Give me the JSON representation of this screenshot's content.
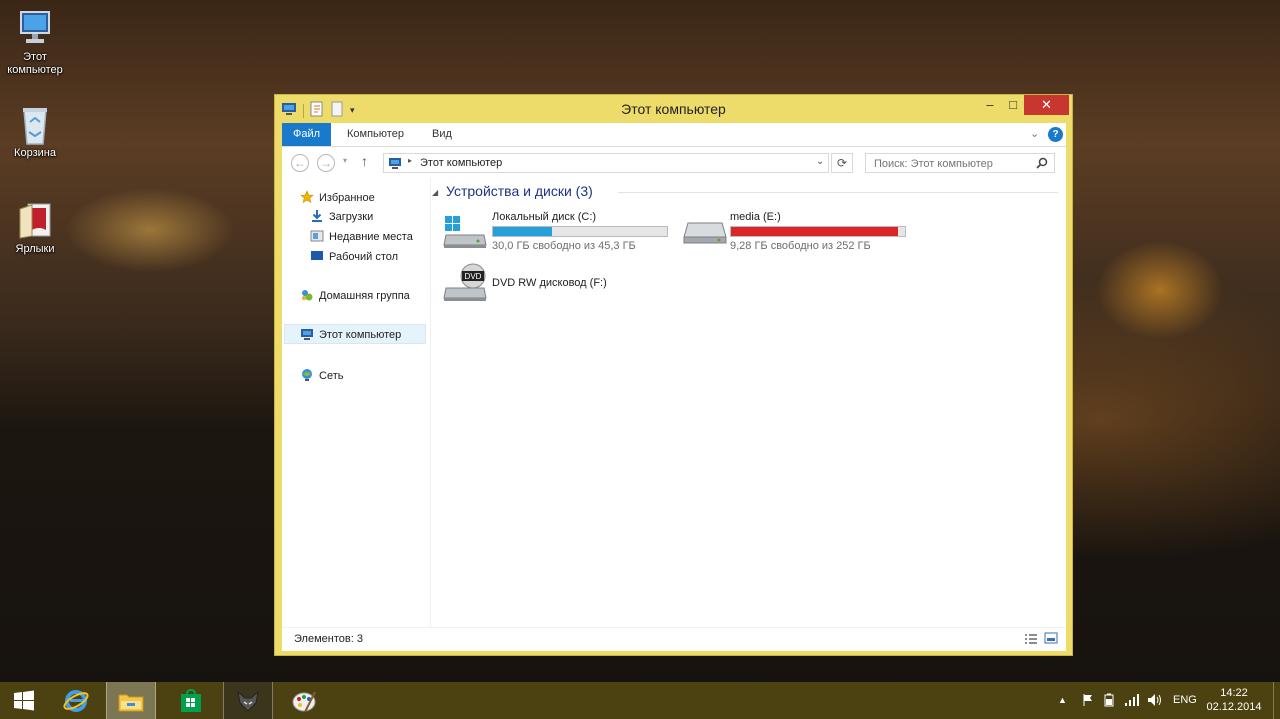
{
  "desktop": {
    "icons": [
      {
        "label_line1": "Этот",
        "label_line2": "компьютер",
        "icon": "computer-icon"
      },
      {
        "label_line1": "Корзина",
        "label_line2": "",
        "icon": "recycle-bin-icon"
      },
      {
        "label_line1": "Ярлыки",
        "label_line2": "",
        "icon": "shortcuts-folder-icon"
      }
    ]
  },
  "window": {
    "title": "Этот компьютер",
    "controls": {
      "minimize": "–",
      "maximize": "□",
      "close": "✕"
    },
    "ribbon_tabs": [
      "Файл",
      "Компьютер",
      "Вид"
    ],
    "address": {
      "path": "Этот компьютер"
    },
    "search": {
      "placeholder": "Поиск: Этот компьютер"
    },
    "nav_pane": {
      "favorites": "Избранное",
      "downloads": "Загрузки",
      "recent_places": "Недавние места",
      "desktop": "Рабочий стол",
      "homegroup": "Домашняя группа",
      "this_pc": "Этот компьютер",
      "network": "Сеть"
    },
    "group": {
      "title": "Устройства и диски (3)"
    },
    "drives": [
      {
        "name": "Локальный диск (C:)",
        "free_text": "30,0 ГБ свободно из 45,3 ГБ",
        "used_fraction": 0.34,
        "bar_color": "#26a0da",
        "icon": "windows-drive-icon"
      },
      {
        "name": "media (E:)",
        "free_text": "9,28 ГБ свободно из 252 ГБ",
        "used_fraction": 0.96,
        "bar_color": "#da2626",
        "icon": "hard-drive-icon"
      },
      {
        "name": "DVD RW дисковод (F:)",
        "icon": "dvd-drive-icon",
        "dvd_label": "DVD"
      }
    ],
    "status": {
      "items_count": "Элементов: 3"
    },
    "colors": {
      "frame": "#eddb6a",
      "accent": "#1979ca",
      "close": "#c7372f"
    }
  },
  "taskbar": {
    "buttons": [
      "start-icon",
      "internet-explorer-icon",
      "file-explorer-icon",
      "store-icon",
      "fox-app-icon",
      "paint-app-icon"
    ],
    "language": "ENG",
    "time": "14:22",
    "date": "02.12.2014"
  }
}
